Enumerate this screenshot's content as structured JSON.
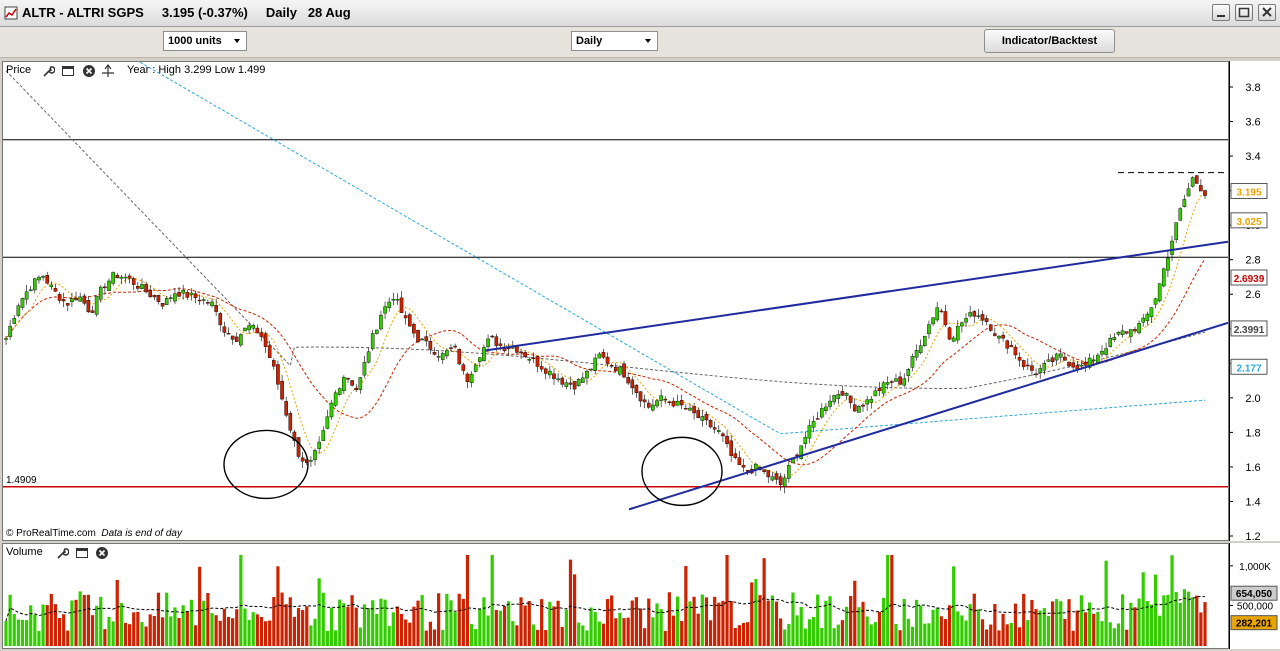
{
  "window": {
    "title": "ALTR - ALTRI SGPS     3.195 (-0.37%)     Daily   28 Aug"
  },
  "toolbar": {
    "units_value": "1000 units",
    "period_value": "Daily",
    "indicator_button": "Indicator/Backtest"
  },
  "price_panel": {
    "label": "Price",
    "year_info": "Year : High 3.299 Low 1.499",
    "support_label": "1.4909",
    "copyright": "© ProRealTime.com",
    "data_note": "Data is end of day"
  },
  "volume_panel": {
    "label": "Volume"
  },
  "icons": [
    "wrench-icon",
    "window-icon",
    "close-icon",
    "crosshair-icon"
  ],
  "colors": {
    "up": "#33cc00",
    "down": "#cc2200",
    "trendline": "#1f2a9e",
    "support": "#cc0000",
    "ma200": "#2aa7d8"
  },
  "chart_data": [
    {
      "type": "candlestick",
      "panel": "price",
      "y_ticks": [
        "3.8",
        "3.6",
        "3.4",
        "3.2",
        "3.0",
        "2.8",
        "2.6",
        "2.4",
        "2.2",
        "2.0",
        "1.8",
        "1.6",
        "1.4",
        "1.2"
      ],
      "ylim": [
        1.2,
        3.9
      ],
      "close_path": [
        2.35,
        2.55,
        2.65,
        2.72,
        2.62,
        2.55,
        2.6,
        2.5,
        2.65,
        2.72,
        2.7,
        2.65,
        2.6,
        2.55,
        2.62,
        2.6,
        2.58,
        2.55,
        2.4,
        2.35,
        2.42,
        2.38,
        2.2,
        1.95,
        1.7,
        1.6,
        1.75,
        2.0,
        2.15,
        2.05,
        2.3,
        2.5,
        2.6,
        2.45,
        2.35,
        2.3,
        2.25,
        2.3,
        2.1,
        2.25,
        2.35,
        2.3,
        2.3,
        2.25,
        2.2,
        2.15,
        2.1,
        2.08,
        2.15,
        2.25,
        2.2,
        2.15,
        2.05,
        1.95,
        2.0,
        1.98,
        1.95,
        1.9,
        1.85,
        1.8,
        1.65,
        1.58,
        1.6,
        1.55,
        1.5,
        1.65,
        1.78,
        1.9,
        2.0,
        2.05,
        1.95,
        1.98,
        2.05,
        2.1,
        2.1,
        2.25,
        2.4,
        2.55,
        2.35,
        2.45,
        2.5,
        2.45,
        2.35,
        2.3,
        2.2,
        2.15,
        2.2,
        2.25,
        2.2,
        2.18,
        2.25,
        2.32,
        2.38,
        2.4,
        2.45,
        2.6,
        2.85,
        3.1,
        3.28,
        3.195
      ],
      "price_labels": [
        {
          "value": "3.195",
          "price": 3.195,
          "color": "#e8a400"
        },
        {
          "value": "3.025",
          "price": 3.025,
          "color": "#e8a400"
        },
        {
          "value": "2.6939",
          "price": 2.6939,
          "color": "#cc0000"
        },
        {
          "value": "2.3991",
          "price": 2.3991,
          "color": "#444444"
        },
        {
          "value": "2.177",
          "price": 2.177,
          "color": "#2aa7d8"
        }
      ],
      "horizontal_lines": [
        {
          "price": 3.5,
          "color": "#000000",
          "style": "solid"
        },
        {
          "price": 2.82,
          "color": "#000000",
          "style": "solid"
        },
        {
          "price": 1.4909,
          "color": "#cc0000",
          "style": "solid"
        },
        {
          "price": 3.31,
          "color": "#000000",
          "style": "dashed"
        }
      ]
    },
    {
      "type": "bar",
      "panel": "volume",
      "y_ticks": [
        "1,000K",
        "500,000"
      ],
      "ylim": [
        0,
        1200000
      ],
      "price_labels": [
        {
          "value": "654,050",
          "volume": 654050,
          "color": "#cccccc"
        },
        {
          "value": "282,201",
          "volume": 282201,
          "color": "#e8a400"
        }
      ]
    }
  ]
}
